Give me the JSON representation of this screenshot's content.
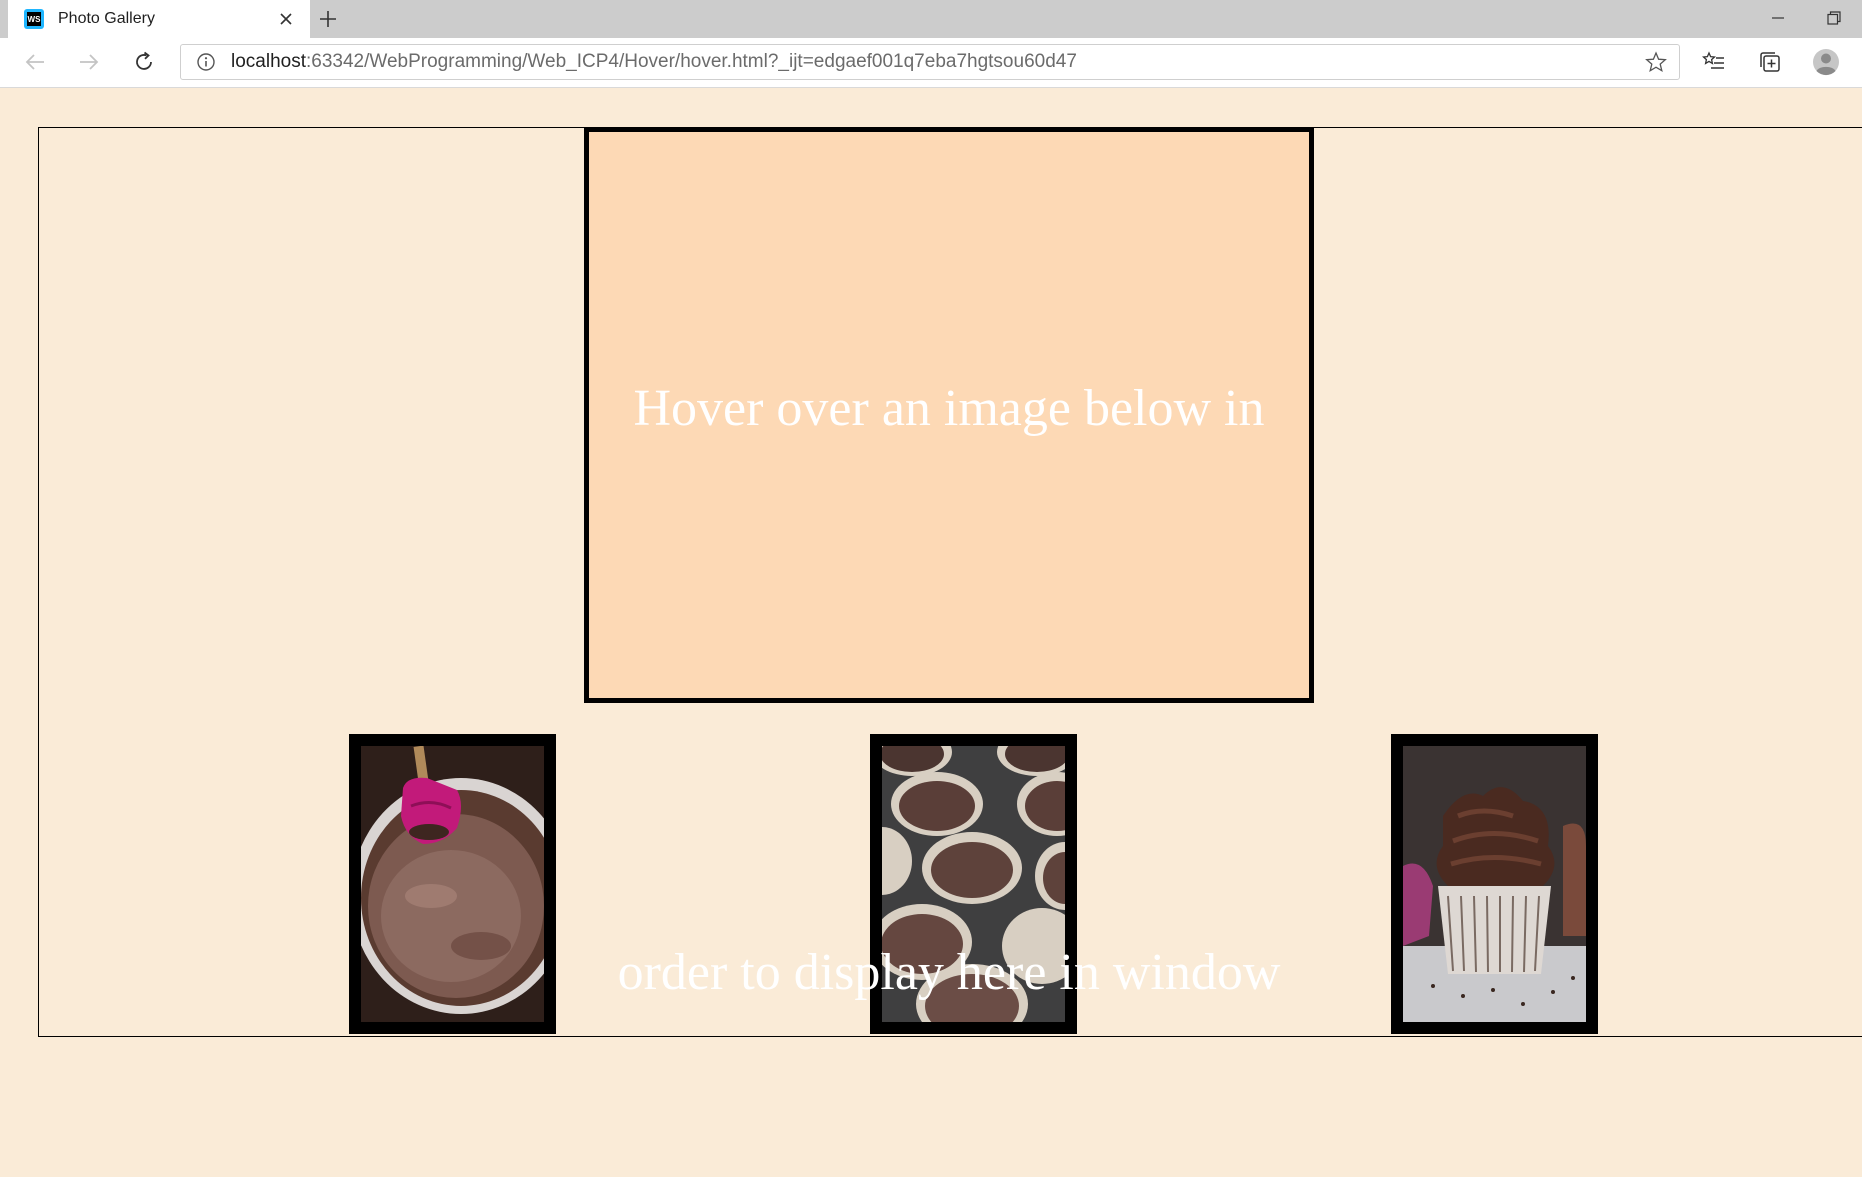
{
  "browser": {
    "tab_title": "Photo Gallery",
    "url_host": "localhost",
    "url_rest": ":63342/WebProgramming/Web_ICP4/Hover/hover.html?_ijt=edgaef001q7eba7hgtsou60d47"
  },
  "page": {
    "display_text": "Hover over an image below in order to display here in window"
  },
  "images": [
    {
      "subject": "chocolate batter in mixing bowl with pink spatula"
    },
    {
      "subject": "cupcake pan with batter filled liners"
    },
    {
      "subject": "chocolate frosted cupcake with sprinkles"
    }
  ],
  "colors": {
    "page_background": "#faebd7",
    "display_background": "#fdd9b5",
    "display_text": "#ffffff",
    "borders": "#000000"
  }
}
